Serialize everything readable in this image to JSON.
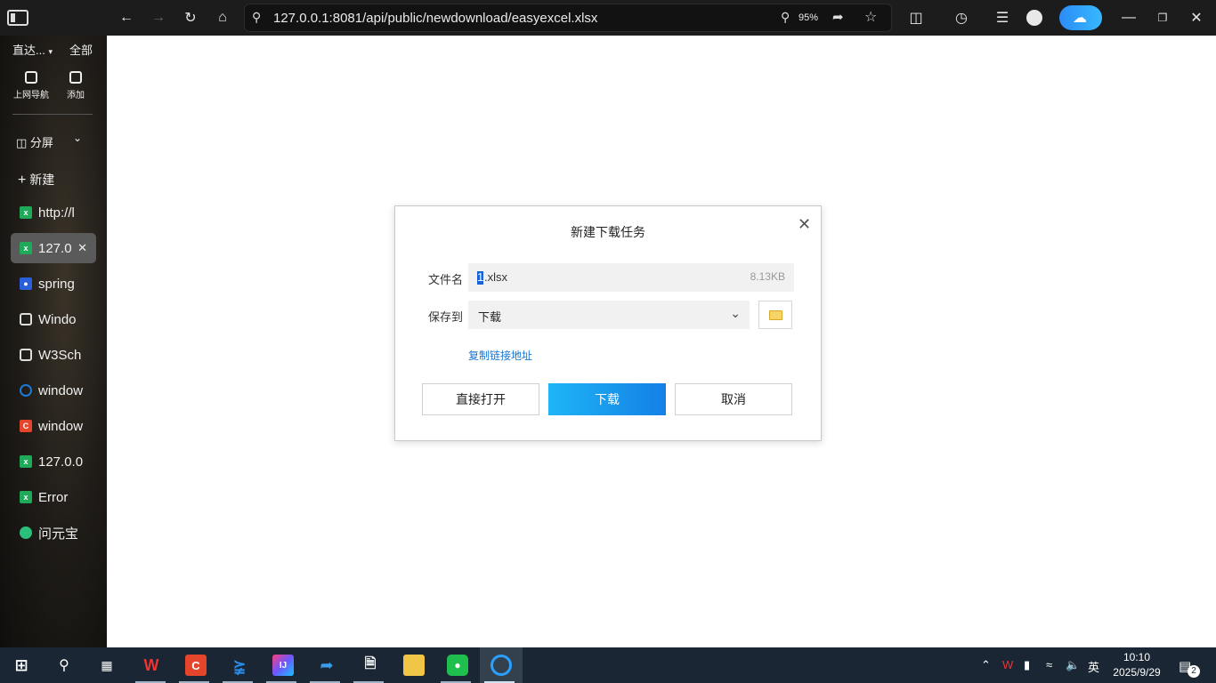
{
  "browser": {
    "url": "127.0.0.1:8081/api/public/newdownload/easyexcel.xlsx",
    "zoom": "95%"
  },
  "sidebar": {
    "top_label": "直达...",
    "all_label": "全部",
    "apps": [
      {
        "label": "上网导航"
      },
      {
        "label": "添加"
      }
    ],
    "split_label": "分屏",
    "new_label": "新建",
    "tabs": [
      {
        "label": "http://l",
        "icon": "excel-icon",
        "color": "#1faa5a"
      },
      {
        "label": "127.0",
        "icon": "excel-icon",
        "color": "#1faa5a",
        "active": true
      },
      {
        "label": "spring",
        "icon": "baidu-paw-icon",
        "color": "#2b5fd9"
      },
      {
        "label": "Windo",
        "icon": "hexagon-icon",
        "color": "#ddd"
      },
      {
        "label": "W3Sch",
        "icon": "hexagon-icon",
        "color": "#ddd"
      },
      {
        "label": "window",
        "icon": "circle-icon",
        "color": "#1a7ad4"
      },
      {
        "label": "window",
        "icon": "csdn-icon",
        "color": "#e5462b"
      },
      {
        "label": "127.0.0",
        "icon": "excel-icon",
        "color": "#1faa5a"
      },
      {
        "label": "Error",
        "icon": "excel-icon",
        "color": "#1faa5a"
      },
      {
        "label": "问元宝",
        "icon": "yuanbao-icon",
        "color": "#2bc07a"
      }
    ]
  },
  "dialog": {
    "title": "新建下载任务",
    "filename_label": "文件名",
    "filename_selected": "1",
    "filename_rest": ".xlsx",
    "file_size": "8.13KB",
    "saveto_label": "保存到",
    "saveto_value": "下载",
    "copy_link": "复制链接地址",
    "btn_open": "直接打开",
    "btn_download": "下载",
    "btn_cancel": "取消"
  },
  "taskbar": {
    "time": "10:10",
    "date": "2025/9/29",
    "ime": "英",
    "notifications": "2"
  }
}
